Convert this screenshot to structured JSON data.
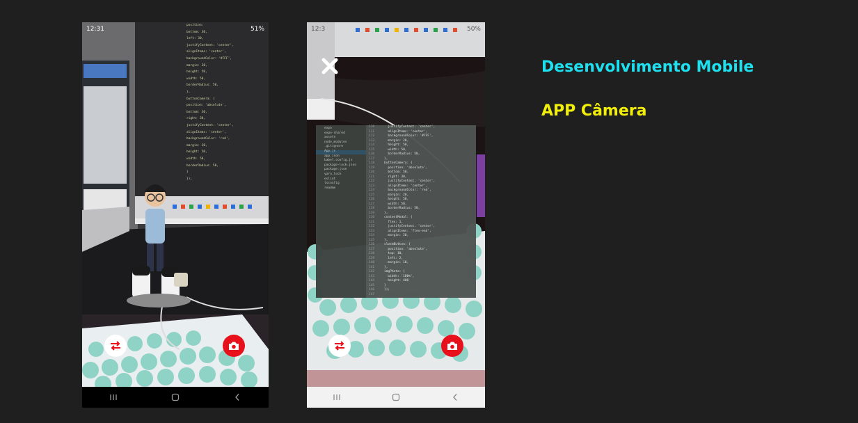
{
  "heading": {
    "title": "Desenvolvimento Mobile",
    "subtitle": "APP Câmera"
  },
  "phone_left": {
    "status_time": "12:31",
    "status_right": "51%",
    "code_lines": [
      "position:",
      "bottom: 30,",
      "left: 30,",
      "justifyContent: 'center',",
      "alignItems: 'center',",
      "backgroundColor: '#FFF',",
      "margin: 20,",
      "height: 50,",
      "width: 50,",
      "borderRadius: 50,",
      "},",
      "buttonCamera: {",
      "position: 'absolute',",
      "bottom: 30,",
      "right: 30,",
      "justifyContent: 'center',",
      "alignItems: 'center',",
      "backgroundColor: 'red',",
      "margin: 20,",
      "height: 50,",
      "width: 50,",
      "borderRadius: 50,",
      "}",
      "});"
    ]
  },
  "phone_right": {
    "status_time": "12:3",
    "status_right": "50%",
    "file_tree": [
      "expo",
      "expo-shared",
      "assets",
      "node_modules",
      ".gitignore",
      "App.js",
      "app.json",
      "babel.config.js",
      "package-lock.json",
      "package.json",
      "yarn.lock",
      "eslint",
      "tsconfig",
      "readme"
    ],
    "line_numbers": [
      "110",
      "111",
      "112",
      "113",
      "114",
      "115",
      "116",
      "117",
      "118",
      "119",
      "120",
      "121",
      "122",
      "123",
      "124",
      "125",
      "126",
      "127",
      "128",
      "129",
      "130",
      "131",
      "132",
      "133",
      "134",
      "135",
      "136",
      "137",
      "138",
      "139",
      "140",
      "141",
      "142",
      "143",
      "144",
      "145",
      "146",
      "147"
    ],
    "code_lines": [
      "  justifyContent: 'center',",
      "  alignItems: 'center',",
      "  backgroundColor: '#FFF',",
      "  margin: 20,",
      "  height: 50,",
      "  width: 50,",
      "  borderRadius: 50,",
      "},",
      "buttonCamera: {",
      "  position: 'absolute',",
      "  bottom: 50,",
      "  right: 30,",
      "  justifyContent: 'center',",
      "  alignItems: 'center',",
      "  backgroundColor: 'red',",
      "  margin: 20,",
      "  height: 50,",
      "  width: 50,",
      "  borderRadius: 50,",
      "},",
      "contentModal: {",
      "  flex: 1,",
      "  justifyContent: 'center',",
      "  alignItems: 'flex-end',",
      "  margin: 20,",
      "},",
      "closeButton: {",
      "  position: 'absolute',",
      "  top: 10,",
      "  left: 2,",
      "  margin: 10,",
      "},",
      "imgPhoto: {",
      "  width: '100%',",
      "  height: 400",
      "}",
      "});",
      ""
    ]
  },
  "colors": {
    "background": "#1f1f1f",
    "title": "#1ee0ee",
    "subtitle": "#f2ee0c",
    "camera_button": "#e8101a",
    "flip_button": "#ffffff",
    "keyboard_keys": "#8fd3c6"
  },
  "icons": {
    "flip": "swap-arrows-icon",
    "camera": "camera-icon",
    "close": "close-icon",
    "nav_recent": "recent-apps-icon",
    "nav_home": "home-icon",
    "nav_back": "back-icon"
  }
}
